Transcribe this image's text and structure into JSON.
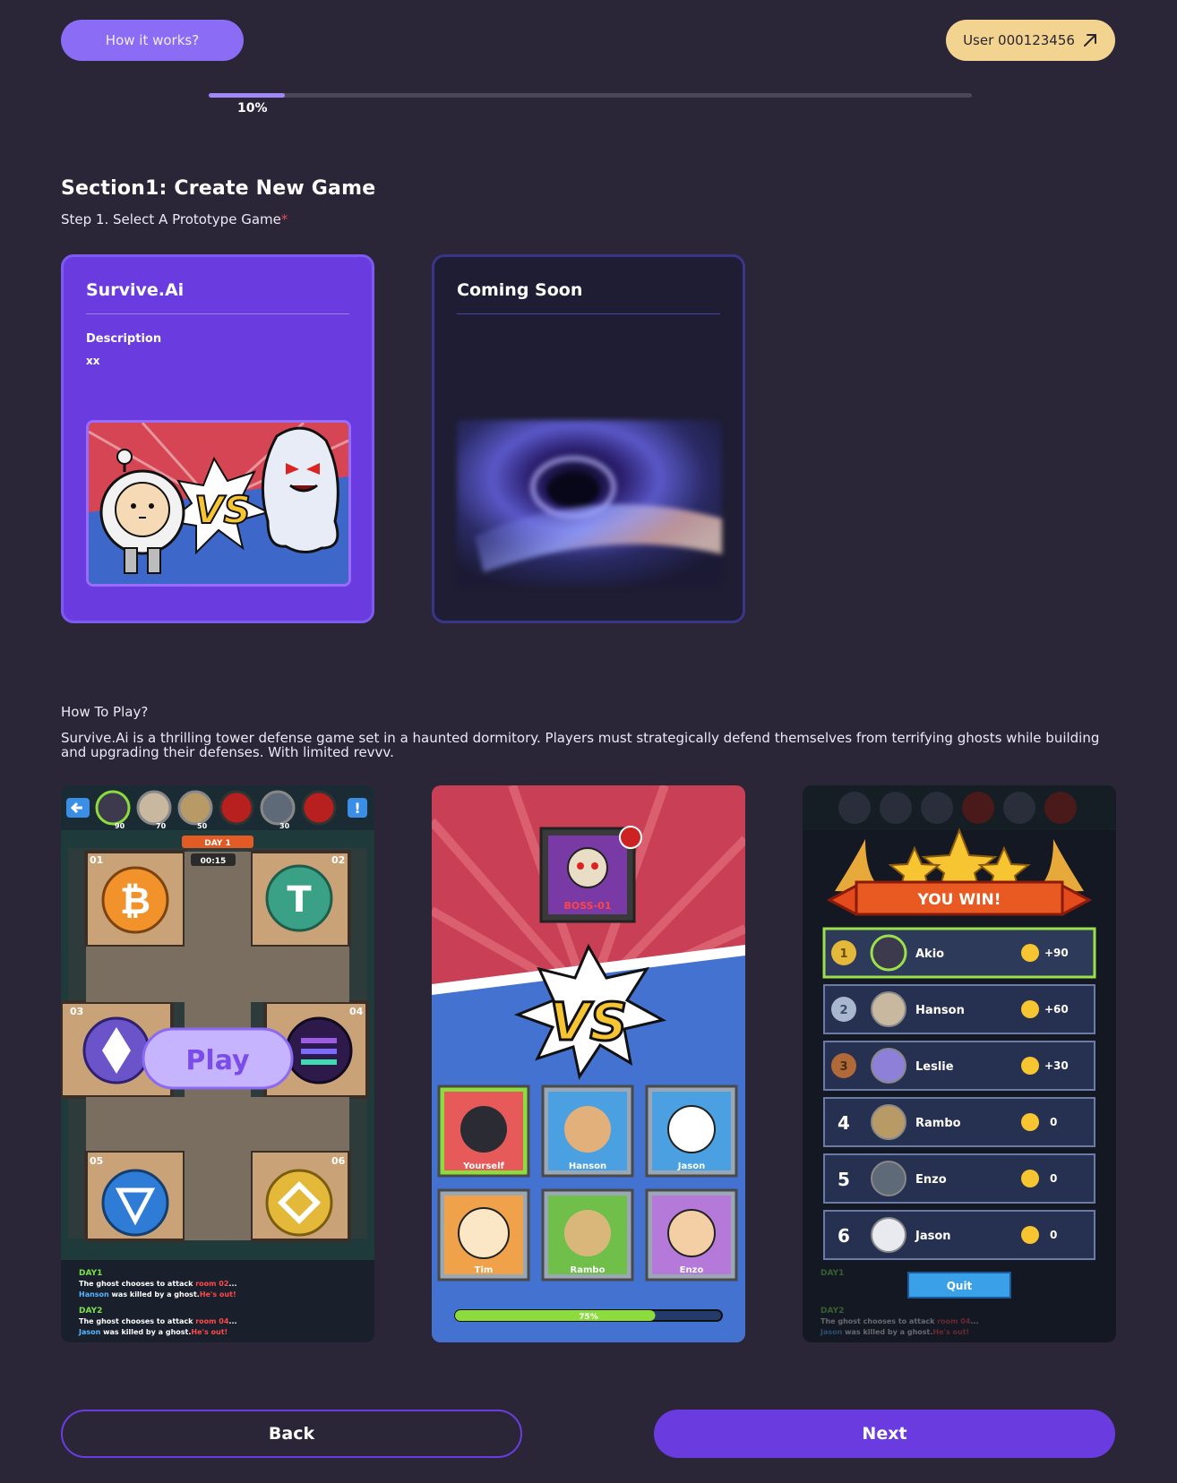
{
  "header": {
    "how_it_works_label": "How it works?",
    "user_label": "User 000123456"
  },
  "progress": {
    "value": 0.1,
    "label": "10%"
  },
  "section": {
    "title": "Section1: Create New Game",
    "step_label": "Step 1. Select A Prototype Game",
    "required_mark": "*"
  },
  "games": [
    {
      "title": "Survive.Ai",
      "description_label": "Description",
      "description_value": "xx",
      "selected": true
    },
    {
      "title": "Coming Soon",
      "selected": false
    }
  ],
  "how_to_play": {
    "title": "How To Play?",
    "text": "Survive.Ai is a thrilling tower defense game set in a haunted dormitory. Players must strategically defend themselves from terrifying ghosts while building and upgrading their defenses. With limited revvv."
  },
  "screens": {
    "board": {
      "score_tags": [
        "90",
        "70",
        "50",
        "30"
      ],
      "day_banner": "DAY 1",
      "timer": "00:15",
      "rooms": [
        "01",
        "02",
        "03",
        "04",
        "05",
        "06"
      ],
      "play_label": "Play",
      "log": [
        {
          "day": "DAY1",
          "line1_prefix": "The ghost chooses to attack ",
          "line1_room": "room 02",
          "line1_suffix": "...",
          "line2_name": "Hanson",
          "line2_text": " was killed by a ghost.",
          "line2_alert": "He's out!"
        },
        {
          "day": "DAY2",
          "line1_prefix": "The ghost chooses to attack ",
          "line1_room": "room 04",
          "line1_suffix": "...",
          "line2_name": "Jason",
          "line2_text": " was killed by a ghost.",
          "line2_alert": "He's out!"
        }
      ]
    },
    "versus": {
      "boss_label": "BOSS-01",
      "vs_label": "VS",
      "players": [
        "Yourself",
        "Hanson",
        "Jason",
        "Tim",
        "Rambo",
        "Enzo"
      ],
      "loading_value": 0.75,
      "loading_label": "75%"
    },
    "results": {
      "banner": "YOU WIN!",
      "rows": [
        {
          "rank": "1",
          "name": "Akio",
          "coins": "+90"
        },
        {
          "rank": "2",
          "name": "Hanson",
          "coins": "+60"
        },
        {
          "rank": "3",
          "name": "Leslie",
          "coins": "+30"
        },
        {
          "rank": "4",
          "name": "Rambo",
          "coins": "0"
        },
        {
          "rank": "5",
          "name": "Enzo",
          "coins": "0"
        },
        {
          "rank": "6",
          "name": "Jason",
          "coins": "0"
        }
      ],
      "quit_label": "Quit"
    }
  },
  "footer": {
    "back_label": "Back",
    "next_label": "Next"
  },
  "colors": {
    "background": "#2a2638",
    "accent": "#6a3ce0",
    "user_button": "#f2d38f",
    "progress": "#a088f8"
  }
}
